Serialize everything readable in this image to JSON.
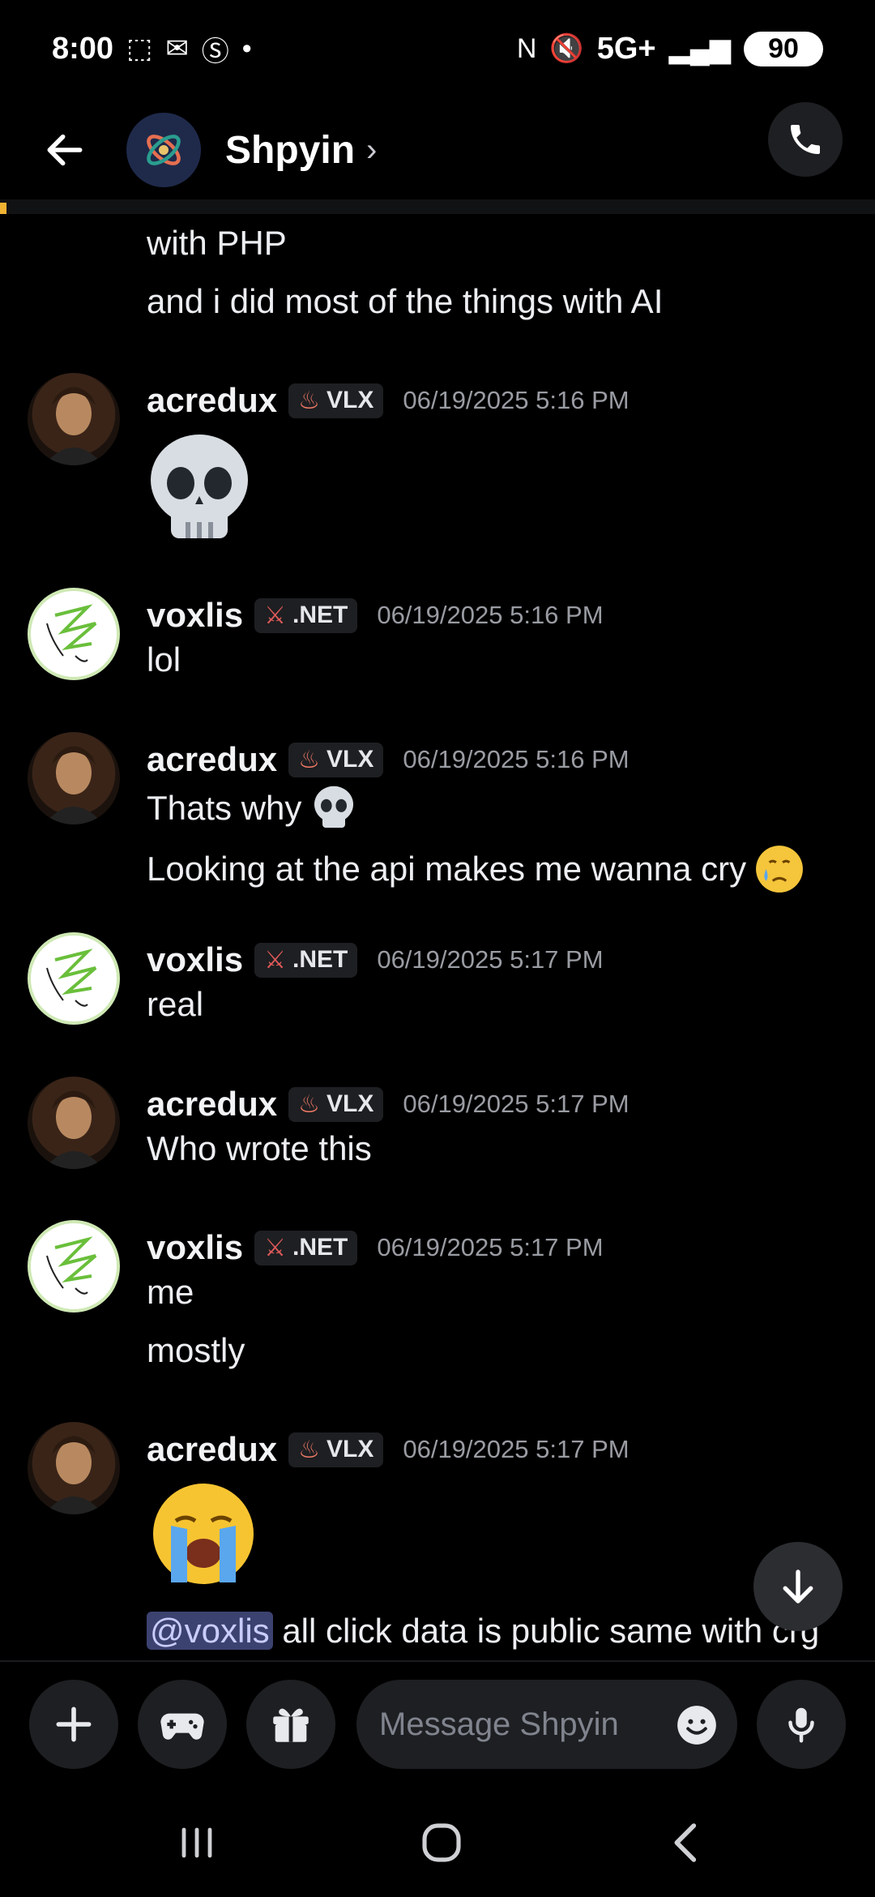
{
  "status_bar": {
    "time": "8:00",
    "network": "5G+",
    "battery": "90"
  },
  "header": {
    "title": "Shpyin",
    "chevron": "›"
  },
  "composer": {
    "placeholder": "Message Shpyin"
  },
  "messages": {
    "m0": {
      "line1": "with PHP",
      "line2": "and i did most of the things with AI"
    },
    "m1": {
      "author": "acredux",
      "tag": "VLX",
      "timestamp": "06/19/2025 5:16 PM",
      "content_emoji": "skull"
    },
    "m2": {
      "author": "voxlis",
      "tag": ".NET",
      "timestamp": "06/19/2025 5:16 PM",
      "line1": "lol"
    },
    "m3": {
      "author": "acredux",
      "tag": "VLX",
      "timestamp": "06/19/2025 5:16 PM",
      "line1": "Thats why",
      "line2": "Looking at the api makes me wanna cry"
    },
    "m4": {
      "author": "voxlis",
      "tag": ".NET",
      "timestamp": "06/19/2025 5:17 PM",
      "line1": "real"
    },
    "m5": {
      "author": "acredux",
      "tag": "VLX",
      "timestamp": "06/19/2025 5:17 PM",
      "line1": "Who wrote this"
    },
    "m6": {
      "author": "voxlis",
      "tag": ".NET",
      "timestamp": "06/19/2025 5:17 PM",
      "line1": "me",
      "line2": "mostly"
    },
    "m7": {
      "author": "acredux",
      "tag": "VLX",
      "timestamp": "06/19/2025 5:17 PM",
      "mention": "@voxlis",
      "line2": " all click data is public same with crg"
    }
  },
  "icons": {
    "back": "arrow-left-icon",
    "call": "phone-icon",
    "plus": "plus-icon",
    "games": "gamepad-icon",
    "gift": "gift-icon",
    "emoji": "emoji-icon",
    "mic": "microphone-icon",
    "scroll": "arrow-down-icon"
  },
  "colors": {
    "background": "#000000",
    "mention_bg": "#3c4270",
    "accent": "#f0b232"
  }
}
